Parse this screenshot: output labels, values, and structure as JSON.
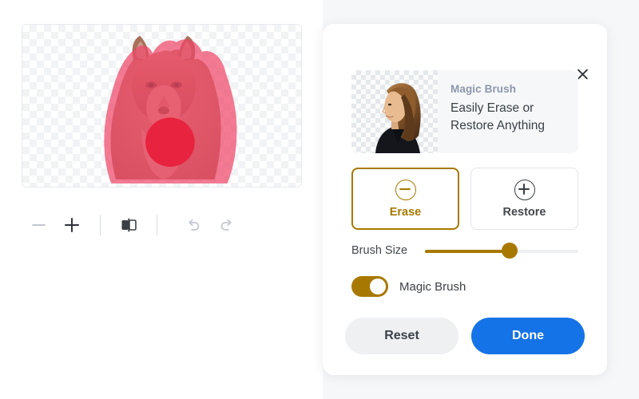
{
  "editor": {
    "canvas": {
      "name": "image-canvas",
      "subject": "wolf-portrait",
      "mask_color": "#ef4668",
      "brush_dot_color": "#e8233f",
      "checker_light": "#ffffff",
      "checker_dark": "#f1f3f5"
    },
    "toolbar": {
      "zoom_out_label": "−",
      "zoom_in_label": "+",
      "compare_label": "Compare",
      "undo_label": "Undo",
      "redo_label": "Redo"
    }
  },
  "panel": {
    "close_label": "×",
    "promo": {
      "eyebrow": "Magic Brush",
      "headline": "Easily Erase or Restore Anything"
    },
    "modes": [
      {
        "id": "erase",
        "label": "Erase",
        "icon": "circle-minus-icon",
        "active": true
      },
      {
        "id": "restore",
        "label": "Restore",
        "icon": "circle-plus-icon",
        "active": false
      }
    ],
    "brush_size": {
      "label": "Brush Size",
      "value": 55,
      "min": 0,
      "max": 100
    },
    "magic_brush": {
      "label": "Magic Brush",
      "enabled": true
    },
    "footer": {
      "reset_label": "Reset",
      "done_label": "Done"
    }
  },
  "colors": {
    "accent_gold": "#a87900",
    "primary_blue": "#1473e6",
    "panel_bg": "#ffffff",
    "page_bg": "#f6f7f9"
  }
}
